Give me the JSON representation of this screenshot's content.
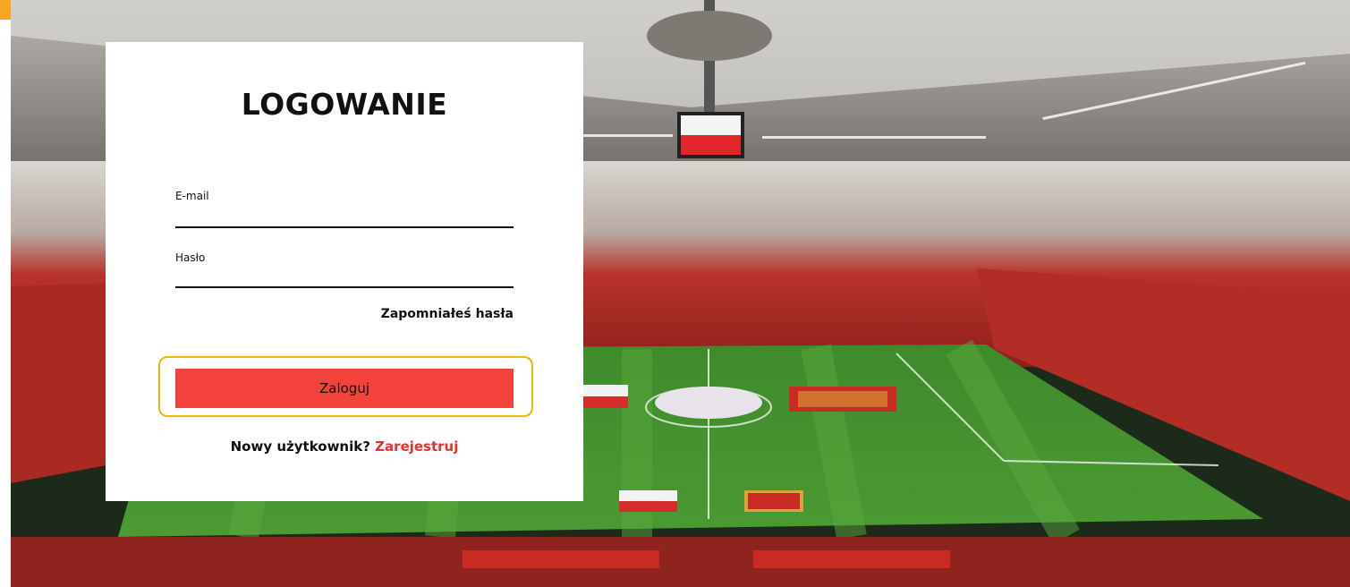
{
  "login": {
    "title": "LOGOWANIE",
    "email_label": "E-mail",
    "email_value": "",
    "password_label": "Hasło",
    "password_value": "",
    "forgot_password": "Zapomniałeś hasła",
    "submit_label": "Zaloguj",
    "new_user_prompt": "Nowy użytkownik?",
    "register_link": "Zarejestruj"
  },
  "colors": {
    "primary_button": "#f4433c",
    "focus_outline": "#f4b400",
    "register_link": "#e8312b"
  }
}
